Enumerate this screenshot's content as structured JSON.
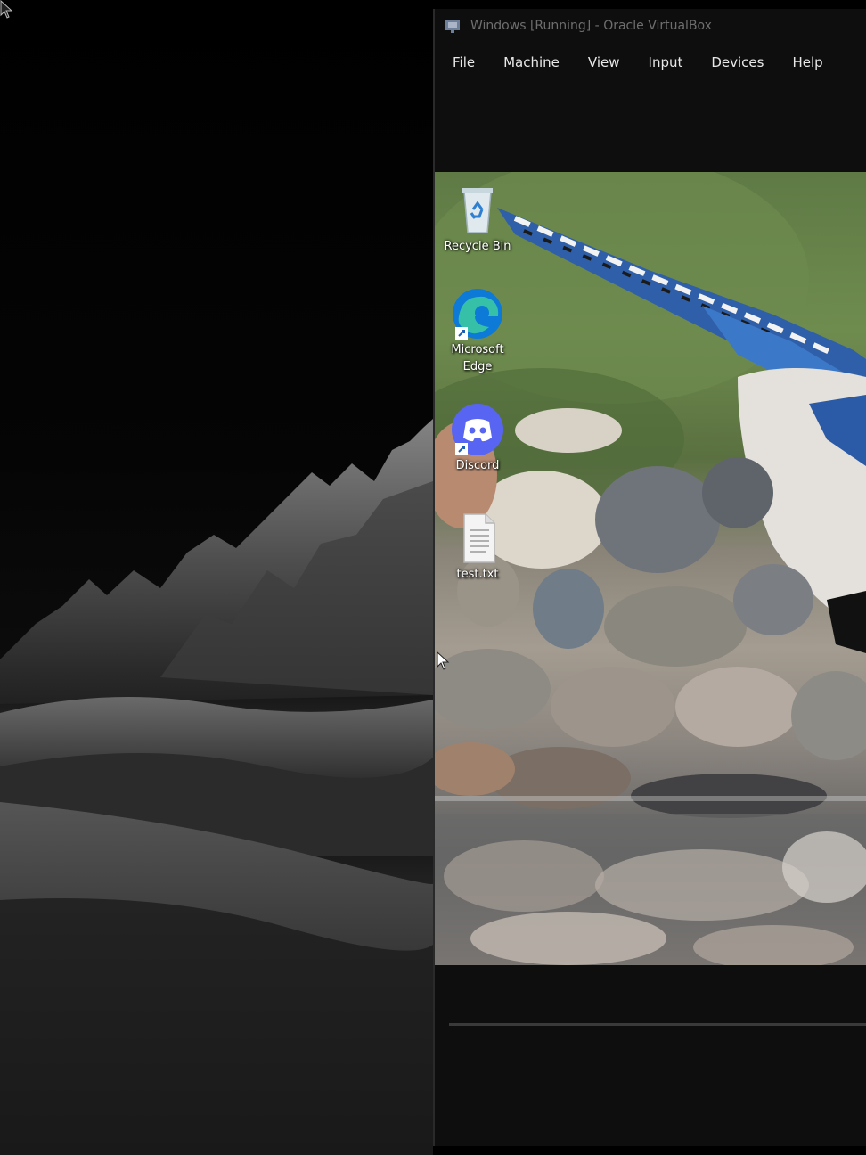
{
  "window": {
    "title": "Windows [Running] - Oracle VirtualBox"
  },
  "menu": [
    {
      "label": "File"
    },
    {
      "label": "Machine"
    },
    {
      "label": "View"
    },
    {
      "label": "Input"
    },
    {
      "label": "Devices"
    },
    {
      "label": "Help"
    }
  ],
  "desktop_icons": [
    {
      "label": "Recycle Bin",
      "icon": "recycle-bin-icon"
    },
    {
      "label": "Microsoft Edge",
      "icon": "edge-icon"
    },
    {
      "label": "Discord",
      "icon": "discord-icon"
    },
    {
      "label": "test.txt",
      "icon": "text-file-icon"
    }
  ],
  "taskbar": {
    "start_icon": "windows-logo-icon",
    "search_icon": "search-icon"
  },
  "colors": {
    "menu_text": "#e8e8e8",
    "title_text": "#6e6e6e",
    "discord_blurple": "#5865f2",
    "windows_blue": "#1e88e5"
  }
}
